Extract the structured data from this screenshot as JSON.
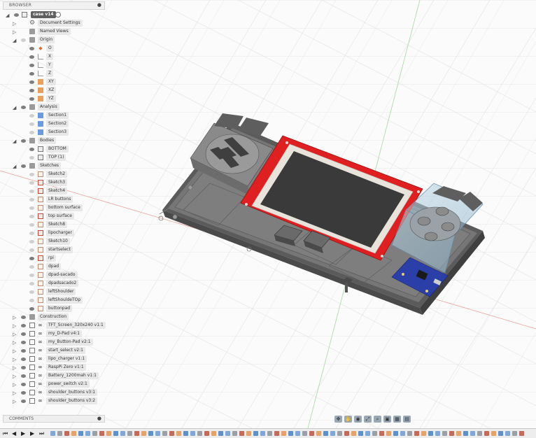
{
  "browser": {
    "title": "BROWSER",
    "root": "case v14",
    "items": [
      {
        "label": "Document Settings",
        "level": 1,
        "icon": "gear-icon",
        "tri": "▷"
      },
      {
        "label": "Named Views",
        "level": 1,
        "icon": "folder-icon",
        "tri": "▷"
      },
      {
        "label": "Origin",
        "level": 1,
        "icon": "folder-icon",
        "tri": "◢",
        "eye": "dim"
      },
      {
        "label": "O",
        "level": 2,
        "icon": "origin-icon",
        "eye": "on"
      },
      {
        "label": "X",
        "level": 2,
        "icon": "axis-icon",
        "eye": "on"
      },
      {
        "label": "Y",
        "level": 2,
        "icon": "axis-icon",
        "eye": "on"
      },
      {
        "label": "Z",
        "level": 2,
        "icon": "axis-icon",
        "eye": "on"
      },
      {
        "label": "XY",
        "level": 2,
        "icon": "plane-icon",
        "eye": "on"
      },
      {
        "label": "XZ",
        "level": 2,
        "icon": "plane-icon",
        "eye": "on"
      },
      {
        "label": "YZ",
        "level": 2,
        "icon": "plane-icon",
        "eye": "on"
      },
      {
        "label": "Analysis",
        "level": 1,
        "icon": "folder-icon",
        "tri": "◢",
        "eye": "on"
      },
      {
        "label": "Section1",
        "level": 2,
        "icon": "section-icon",
        "eye": "dim"
      },
      {
        "label": "Section2",
        "level": 2,
        "icon": "section-icon",
        "eye": "dim"
      },
      {
        "label": "Section3",
        "level": 2,
        "icon": "section-icon",
        "eye": "dim"
      },
      {
        "label": "Bodies",
        "level": 1,
        "icon": "folder-icon",
        "tri": "◢",
        "eye": "on"
      },
      {
        "label": "BOTTOM",
        "level": 2,
        "icon": "body-icon",
        "eye": "on"
      },
      {
        "label": "TOP (1)",
        "level": 2,
        "icon": "body-icon",
        "eye": "dim"
      },
      {
        "label": "Sketches",
        "level": 1,
        "icon": "folder-icon",
        "tri": "◢",
        "eye": "on"
      },
      {
        "label": "Sketch2",
        "level": 2,
        "icon": "sketch-icon",
        "eye": "dim"
      },
      {
        "label": "Sketch3",
        "level": 2,
        "icon": "sketch-red-icon",
        "eye": "dim"
      },
      {
        "label": "Sketch4",
        "level": 2,
        "icon": "sketch-red-icon",
        "eye": "dim"
      },
      {
        "label": "LR buttons",
        "level": 2,
        "icon": "sketch-icon",
        "eye": "dim"
      },
      {
        "label": "bottom surface",
        "level": 2,
        "icon": "sketch-icon",
        "eye": "dim"
      },
      {
        "label": "top surface",
        "level": 2,
        "icon": "sketch-red-icon",
        "eye": "dim"
      },
      {
        "label": "Sketch8",
        "level": 2,
        "icon": "sketch-icon",
        "eye": "dim"
      },
      {
        "label": "lipocharger",
        "level": 2,
        "icon": "sketch-red-icon",
        "eye": "dim"
      },
      {
        "label": "Sketch10",
        "level": 2,
        "icon": "sketch-icon",
        "eye": "dim"
      },
      {
        "label": "startselect",
        "level": 2,
        "icon": "sketch-icon",
        "eye": "dim"
      },
      {
        "label": "rpi",
        "level": 2,
        "icon": "sketch-red-icon",
        "eye": "on"
      },
      {
        "label": "dpad",
        "level": 2,
        "icon": "sketch-icon",
        "eye": "dim"
      },
      {
        "label": "dpad-sacado",
        "level": 2,
        "icon": "sketch-icon",
        "eye": "dim"
      },
      {
        "label": "dpadsacado2",
        "level": 2,
        "icon": "sketch-icon",
        "eye": "dim"
      },
      {
        "label": "leftShoulder",
        "level": 2,
        "icon": "sketch-icon",
        "eye": "dim"
      },
      {
        "label": "leftShouldeTOp",
        "level": 2,
        "icon": "sketch-icon",
        "eye": "dim"
      },
      {
        "label": "buttonpad",
        "level": 2,
        "icon": "sketch-icon",
        "eye": "on"
      },
      {
        "label": "Construction",
        "level": 1,
        "icon": "folder-icon",
        "tri": "▷",
        "eye": "on"
      },
      {
        "label": "TFT_Screen_320x240 v1:1",
        "level": 1,
        "icon": "component-icon",
        "tri": "▷",
        "eye": "on",
        "link": true
      },
      {
        "label": "my_D-Pad v4:1",
        "level": 1,
        "icon": "component-icon",
        "tri": "▷",
        "eye": "on",
        "link": true
      },
      {
        "label": "my_Button-Pad v2:1",
        "level": 1,
        "icon": "component-icon",
        "tri": "▷",
        "eye": "on",
        "link": true
      },
      {
        "label": "start_select v2:1",
        "level": 1,
        "icon": "component-icon",
        "tri": "▷",
        "eye": "on",
        "link": true
      },
      {
        "label": "lipo_charger v1:1",
        "level": 1,
        "icon": "component-icon",
        "tri": "▷",
        "eye": "on",
        "link": true
      },
      {
        "label": "RaspPi Zero v1:1",
        "level": 1,
        "icon": "component-icon",
        "tri": "▷",
        "eye": "on",
        "link": true
      },
      {
        "label": "Battery_1200mah v1:1",
        "level": 1,
        "icon": "component-icon",
        "tri": "▷",
        "eye": "on",
        "link": true
      },
      {
        "label": "power_switch v2:1",
        "level": 1,
        "icon": "component-icon",
        "tri": "▷",
        "eye": "on",
        "link": true
      },
      {
        "label": "shoulder_buttons v3:1",
        "level": 1,
        "icon": "component-icon",
        "tri": "▷",
        "eye": "on",
        "link": true
      },
      {
        "label": "shoulder_buttons v3:2",
        "level": 1,
        "icon": "component-icon",
        "tri": "▷",
        "eye": "on",
        "link": true
      }
    ]
  },
  "comments": {
    "title": "COMMENTS"
  },
  "nav_toolbar": [
    "orbit-icon",
    "pan-icon",
    "look-icon",
    "fit-icon",
    "zoom-icon",
    "display-settings-icon",
    "grid-icon",
    "viewports-icon"
  ],
  "timeline": {
    "controls": [
      "skip-start-icon",
      "step-back-icon",
      "play-icon",
      "step-forward-icon",
      "skip-end-icon"
    ]
  },
  "colors": {
    "grid": "#dcdcdc",
    "origin_red": "#e88a7c",
    "origin_green": "#9fd19b",
    "case_gray": "#6e6e6e",
    "screen_frame": "#e02020",
    "pcb_blue": "#2a3fa8",
    "panel_bg": "#efefef"
  }
}
